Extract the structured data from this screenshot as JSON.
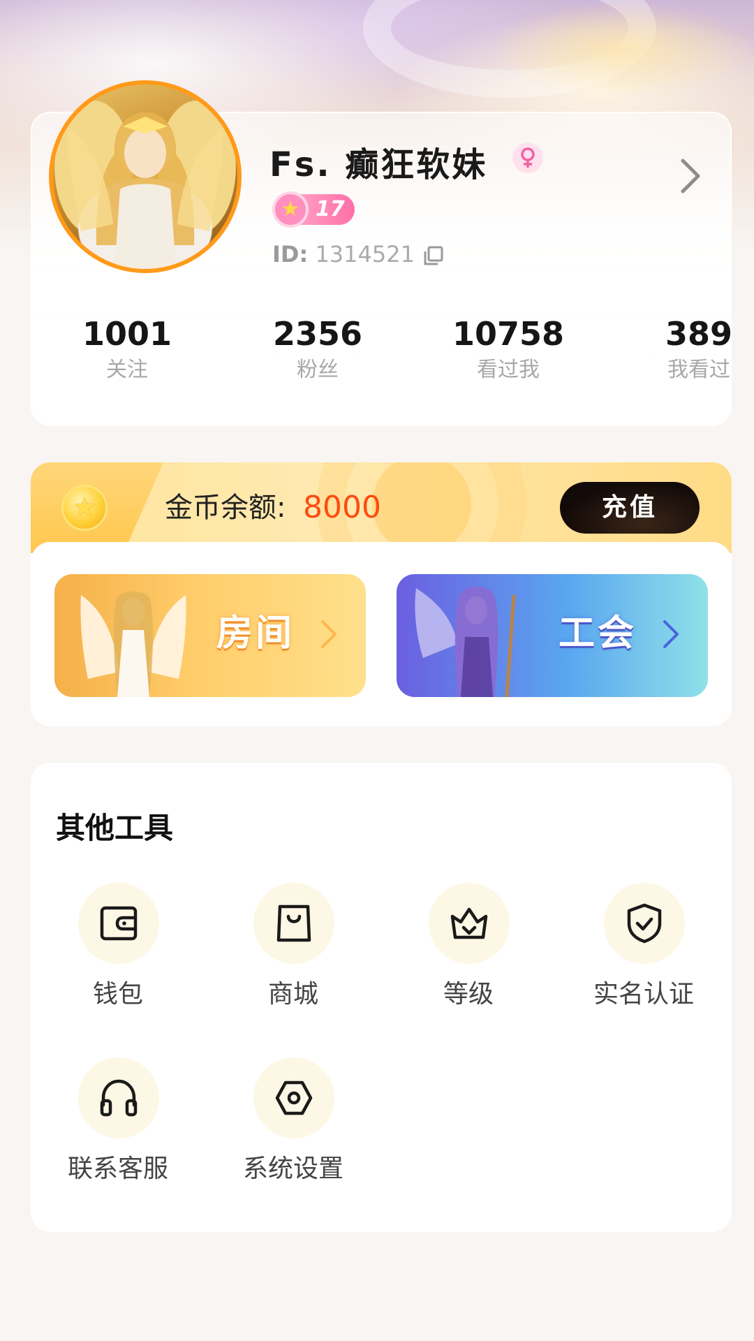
{
  "profile": {
    "name": "Fs. 癫狂软妹",
    "gender_icon": "female-icon",
    "level": "17",
    "id_label": "ID:",
    "id_value": "1314521"
  },
  "stats": [
    {
      "value": "1001",
      "label": "关注"
    },
    {
      "value": "2356",
      "label": "粉丝"
    },
    {
      "value": "10758",
      "label": "看过我"
    },
    {
      "value": "389",
      "label": "我看过"
    }
  ],
  "coins": {
    "label": "金币余额:",
    "amount": "8000",
    "recharge_label": "充值"
  },
  "banners": {
    "room": "房间",
    "guild": "工会"
  },
  "tools": {
    "title": "其他工具",
    "items": [
      {
        "label": "钱包",
        "icon": "wallet-icon"
      },
      {
        "label": "商城",
        "icon": "shopping-bag-icon"
      },
      {
        "label": "等级",
        "icon": "crown-icon"
      },
      {
        "label": "实名认证",
        "icon": "shield-check-icon"
      },
      {
        "label": "联系客服",
        "icon": "headset-icon"
      },
      {
        "label": "系统设置",
        "icon": "settings-icon"
      }
    ]
  },
  "colors": {
    "accent_orange": "#ff9a1a",
    "coin_amount": "#ff4b0f",
    "level_pink": "#ff6fa8"
  }
}
